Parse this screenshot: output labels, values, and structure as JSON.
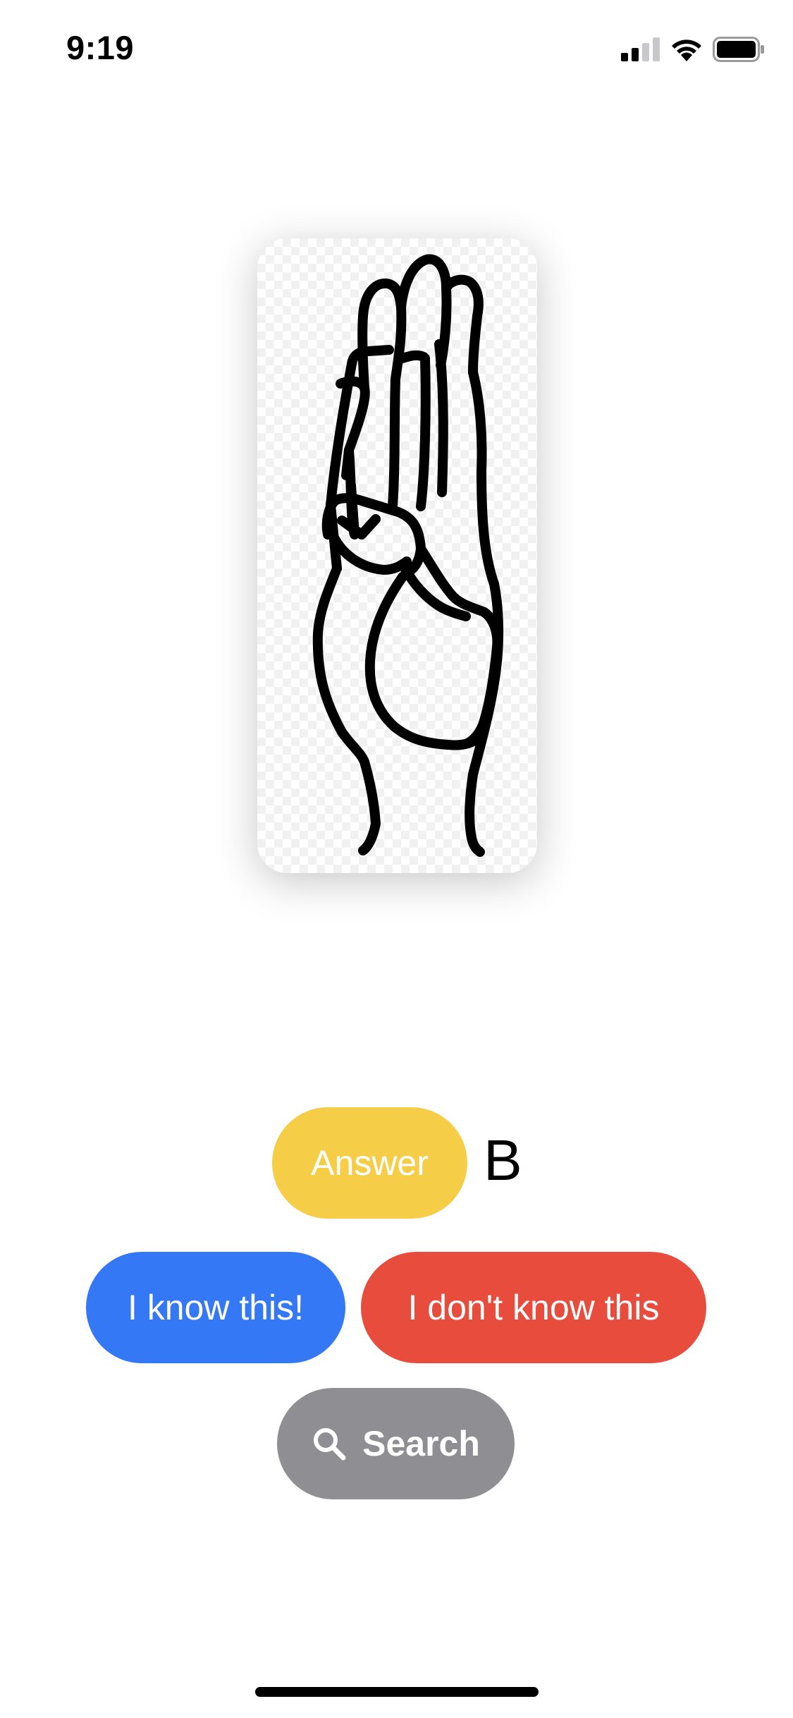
{
  "status_bar": {
    "time": "9:19",
    "icons": [
      "cellular-signal-icon",
      "wifi-icon",
      "battery-icon"
    ]
  },
  "card": {
    "image": "asl-hand-sign-b",
    "icon": "hand-sign-icon"
  },
  "answer": {
    "button_label": "Answer",
    "letter": "B"
  },
  "actions": {
    "know_label": "I know this!",
    "dont_know_label": "I don't know this",
    "search_label": "Search",
    "search_icon": "magnifying-glass-icon"
  },
  "colors": {
    "answer": "#f5cd46",
    "know": "#3478f6",
    "dont_know": "#e84c3d",
    "search": "#8e8e93"
  }
}
